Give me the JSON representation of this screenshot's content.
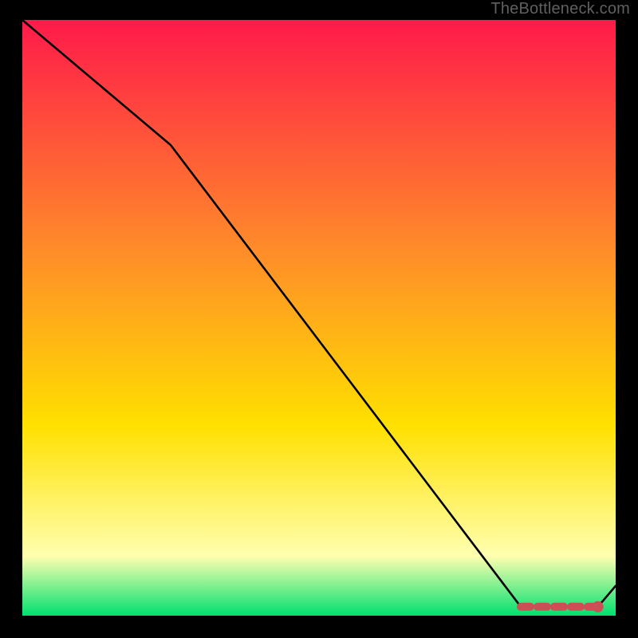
{
  "watermark": "TheBottleneck.com",
  "colors": {
    "gradient_top": "#ff1a4a",
    "gradient_mid1": "#ff8a2a",
    "gradient_mid2": "#ffe000",
    "gradient_pale": "#ffffb0",
    "gradient_bottom": "#00e070",
    "line": "#000000",
    "marker": "#cc4f55",
    "frame_bg": "#000000"
  },
  "chart_data": {
    "type": "line",
    "title": "",
    "xlabel": "",
    "ylabel": "",
    "xlim": [
      0,
      100
    ],
    "ylim": [
      0,
      100
    ],
    "x": [
      0,
      25,
      84,
      97,
      100
    ],
    "values": [
      100,
      79,
      1.5,
      1.5,
      5
    ],
    "marker_segment": {
      "x": [
        84,
        97
      ],
      "values": [
        1.5,
        1.5
      ]
    }
  }
}
